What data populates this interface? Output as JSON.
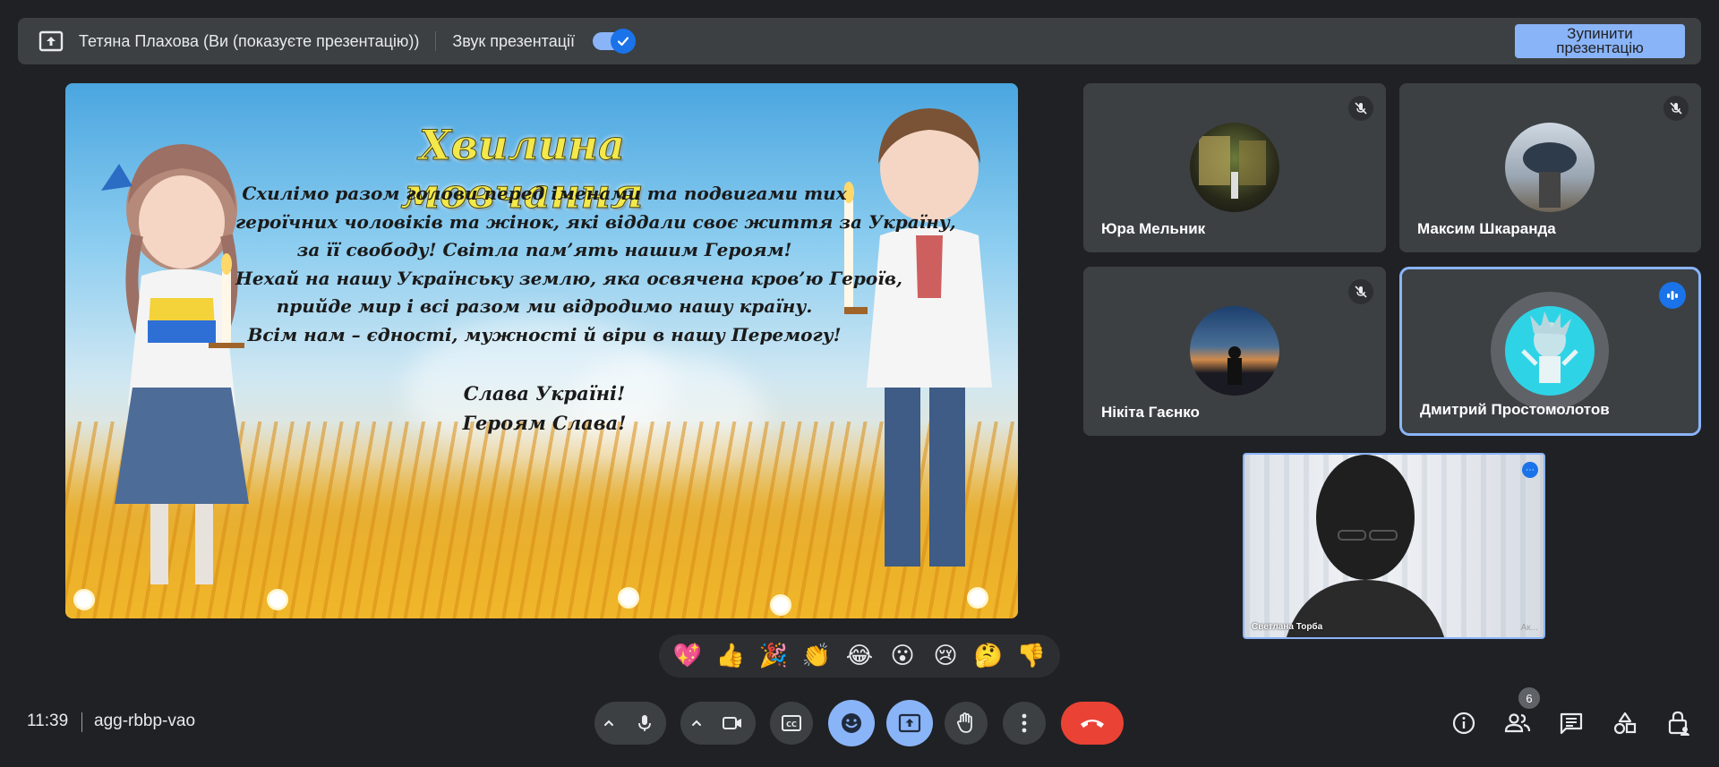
{
  "present_bar": {
    "presenter_name": "Тетяна Плахова (Ви (показуєте презентацію))",
    "sound_label": "Звук презентації",
    "sound_enabled": true,
    "stop_button_label": "Зупинити презентацію"
  },
  "slide": {
    "title": "Хвилина мовчання",
    "lines": [
      "Схилімо разом голови перед іменами та подвигами тих",
      "героїчних чоловіків та жінок, які віддали своє життя за Україну,",
      "за її свободу! Світла пам’ять нашим Героям!",
      "Нехай на нашу Українську землю, яка освячена кров’ю Героїв,",
      "прийде мир і всі разом ми відродимо нашу країну.",
      "Всім нам – єдності, мужності й віри в нашу Перемогу!"
    ],
    "glory": [
      "Слава Україні!",
      "Героям Слава!"
    ]
  },
  "participants": [
    {
      "name": "Юра Мельник",
      "muted": true
    },
    {
      "name": "Максим Шкаранда",
      "muted": true
    },
    {
      "name": "Нікіта Гаєнко",
      "muted": true
    },
    {
      "name": "Дмитрий Простомолотов",
      "muted": false,
      "speaking": true
    }
  ],
  "self_view": {
    "label": "Светлана Торба",
    "watermark": "Ак..."
  },
  "reactions": [
    "💖",
    "👍",
    "🎉",
    "👏",
    "😂",
    "😮",
    "😢",
    "🤔",
    "👎"
  ],
  "bottom": {
    "time": "11:39",
    "meeting_code": "agg-rbbp-vao",
    "participant_count": "6"
  },
  "colors": {
    "accent": "#8ab4f8",
    "leave": "#ea4335",
    "bar": "#3c4043",
    "background": "#202124"
  }
}
